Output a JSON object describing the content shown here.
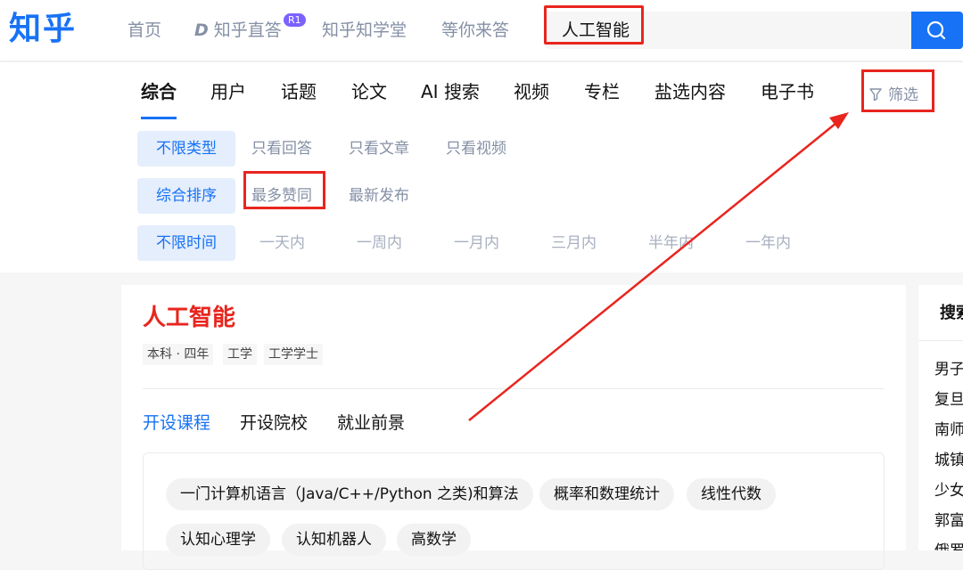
{
  "header": {
    "logo": "知乎",
    "nav": [
      "首页",
      "知乎直答",
      "知乎知学堂",
      "等你来答"
    ],
    "zhida_badge": "R1",
    "zhida_icon_glyph": "D",
    "search_value": "人工智能",
    "search_icon": "search-icon"
  },
  "tabs": [
    "综合",
    "用户",
    "话题",
    "论文",
    "AI 搜索",
    "视频",
    "专栏",
    "盐选内容",
    "电子书"
  ],
  "filter_button": {
    "label": "筛选",
    "icon": "filter-icon"
  },
  "filters": {
    "type": {
      "active": "不限类型",
      "options": [
        "只看回答",
        "只看文章",
        "只看视频"
      ]
    },
    "sort": {
      "active": "综合排序",
      "options": [
        "最多赞同",
        "最新发布"
      ]
    },
    "time": {
      "active": "不限时间",
      "options": [
        "一天内",
        "一周内",
        "一月内",
        "三月内",
        "半年内",
        "一年内"
      ]
    }
  },
  "card": {
    "title": "人工智能",
    "tags": [
      "本科 · 四年",
      "工学",
      "工学学士"
    ],
    "subtabs": [
      "开设课程",
      "开设院校",
      "就业前景"
    ],
    "courses": [
      "一门计算机语言（Java/C++/Python 之类)和算法",
      "概率和数理统计",
      "线性代数",
      "认知心理学",
      "认知机器人",
      "高数学"
    ]
  },
  "side": {
    "title": "搜索",
    "items": [
      "男子",
      "复旦",
      "南师",
      "城镇",
      "少女",
      "郭富",
      "俄罗"
    ]
  },
  "colors": {
    "brand": "#1772f6",
    "annotation": "#e8251e"
  }
}
